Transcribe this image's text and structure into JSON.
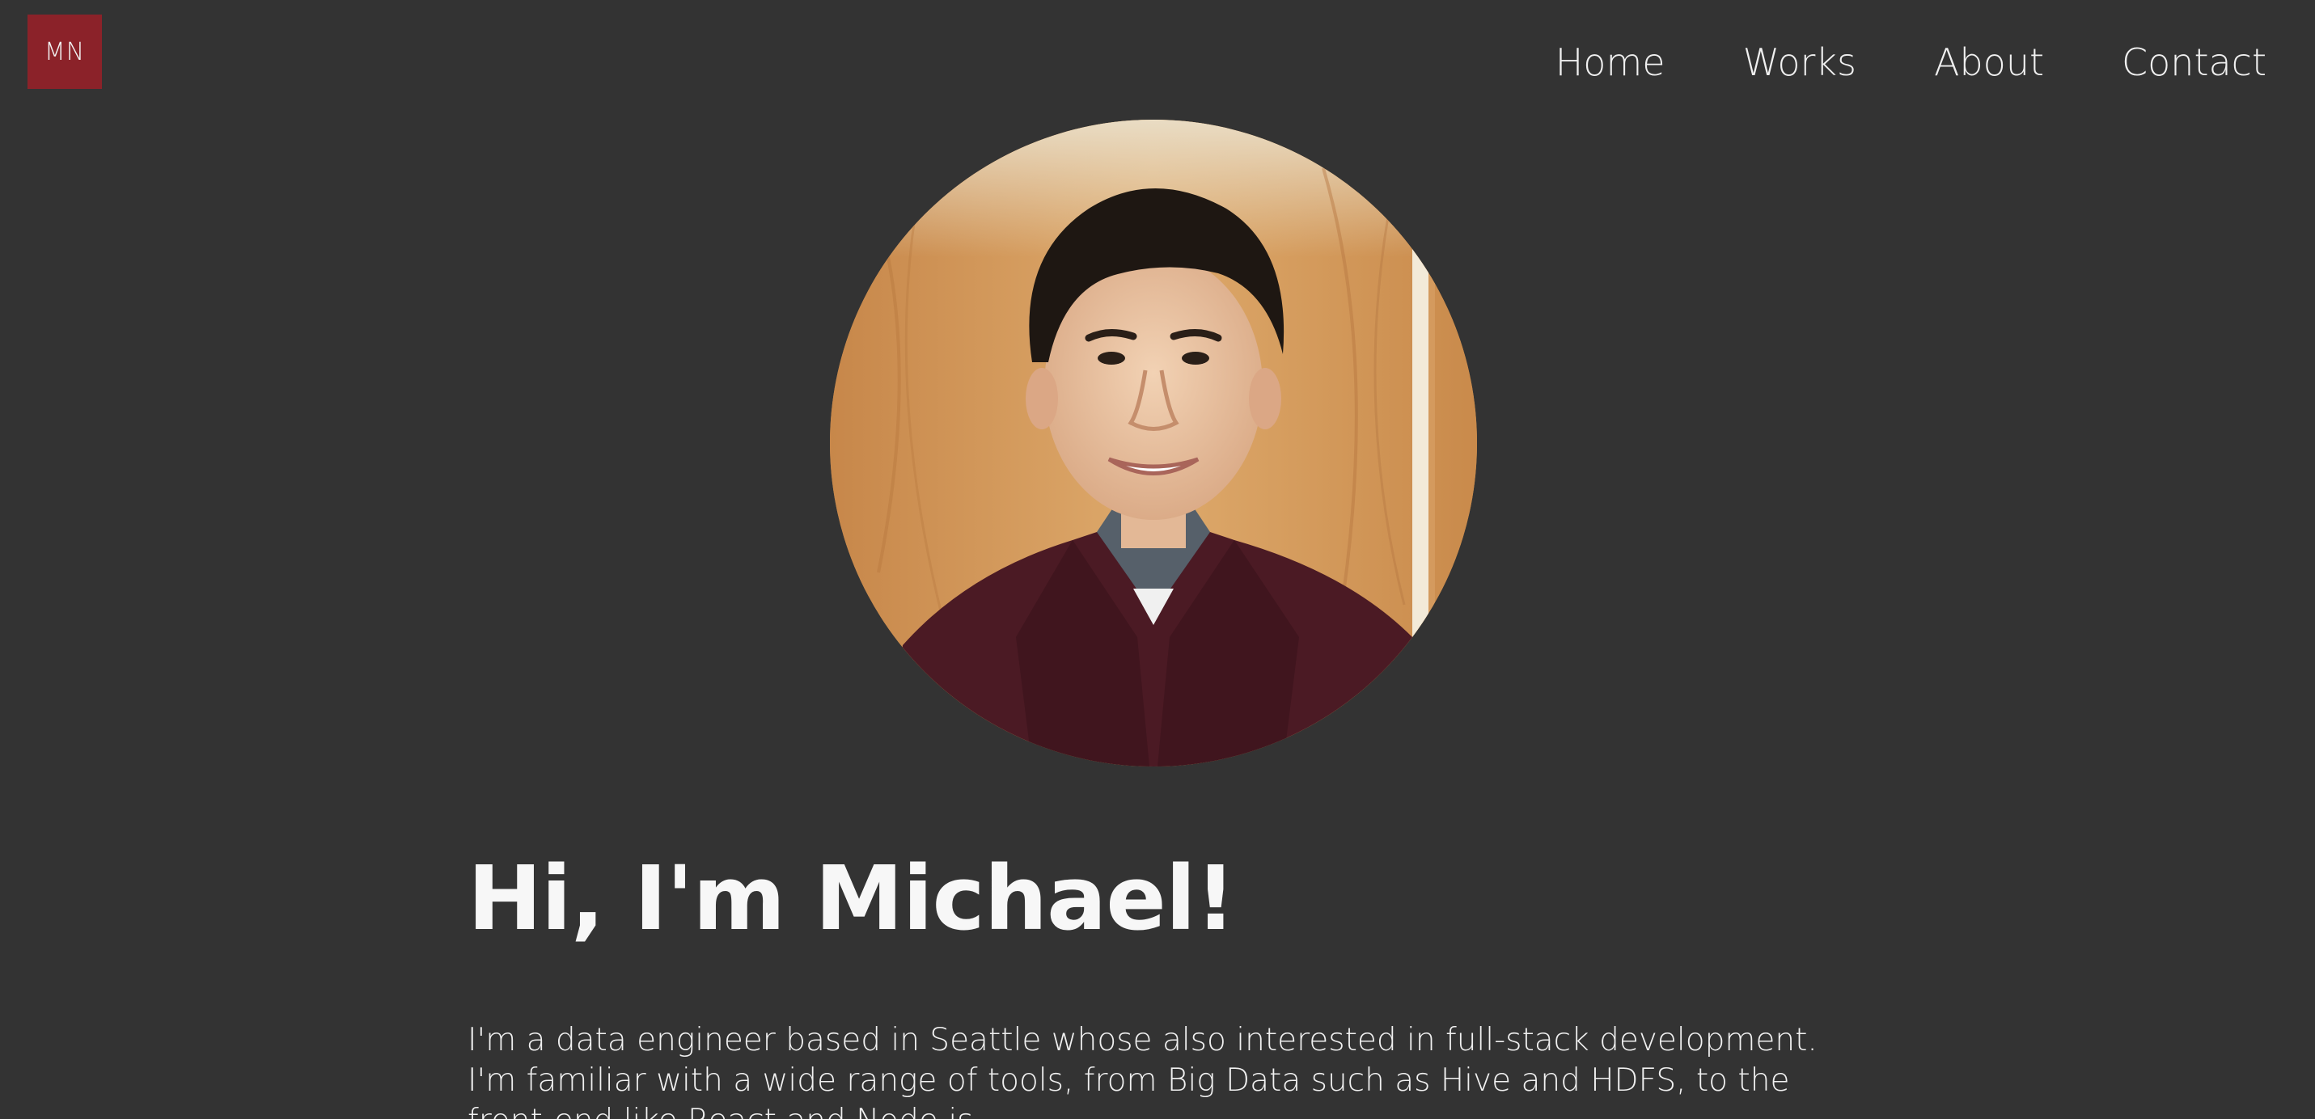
{
  "header": {
    "logo_text": "MN",
    "nav": [
      {
        "label": "Home"
      },
      {
        "label": "Works"
      },
      {
        "label": "About"
      },
      {
        "label": "Contact"
      }
    ]
  },
  "hero": {
    "title": "Hi, I'm Michael!",
    "intro": "I'm a data engineer based in Seattle whose also interested in full-stack development. I'm familiar with a wide range of tools, from Big Data such as Hive and HDFS, to the front-end like React and Node.js."
  },
  "colors": {
    "background": "#333333",
    "logo_background": "#8b2229",
    "text": "#f0f0f0"
  }
}
